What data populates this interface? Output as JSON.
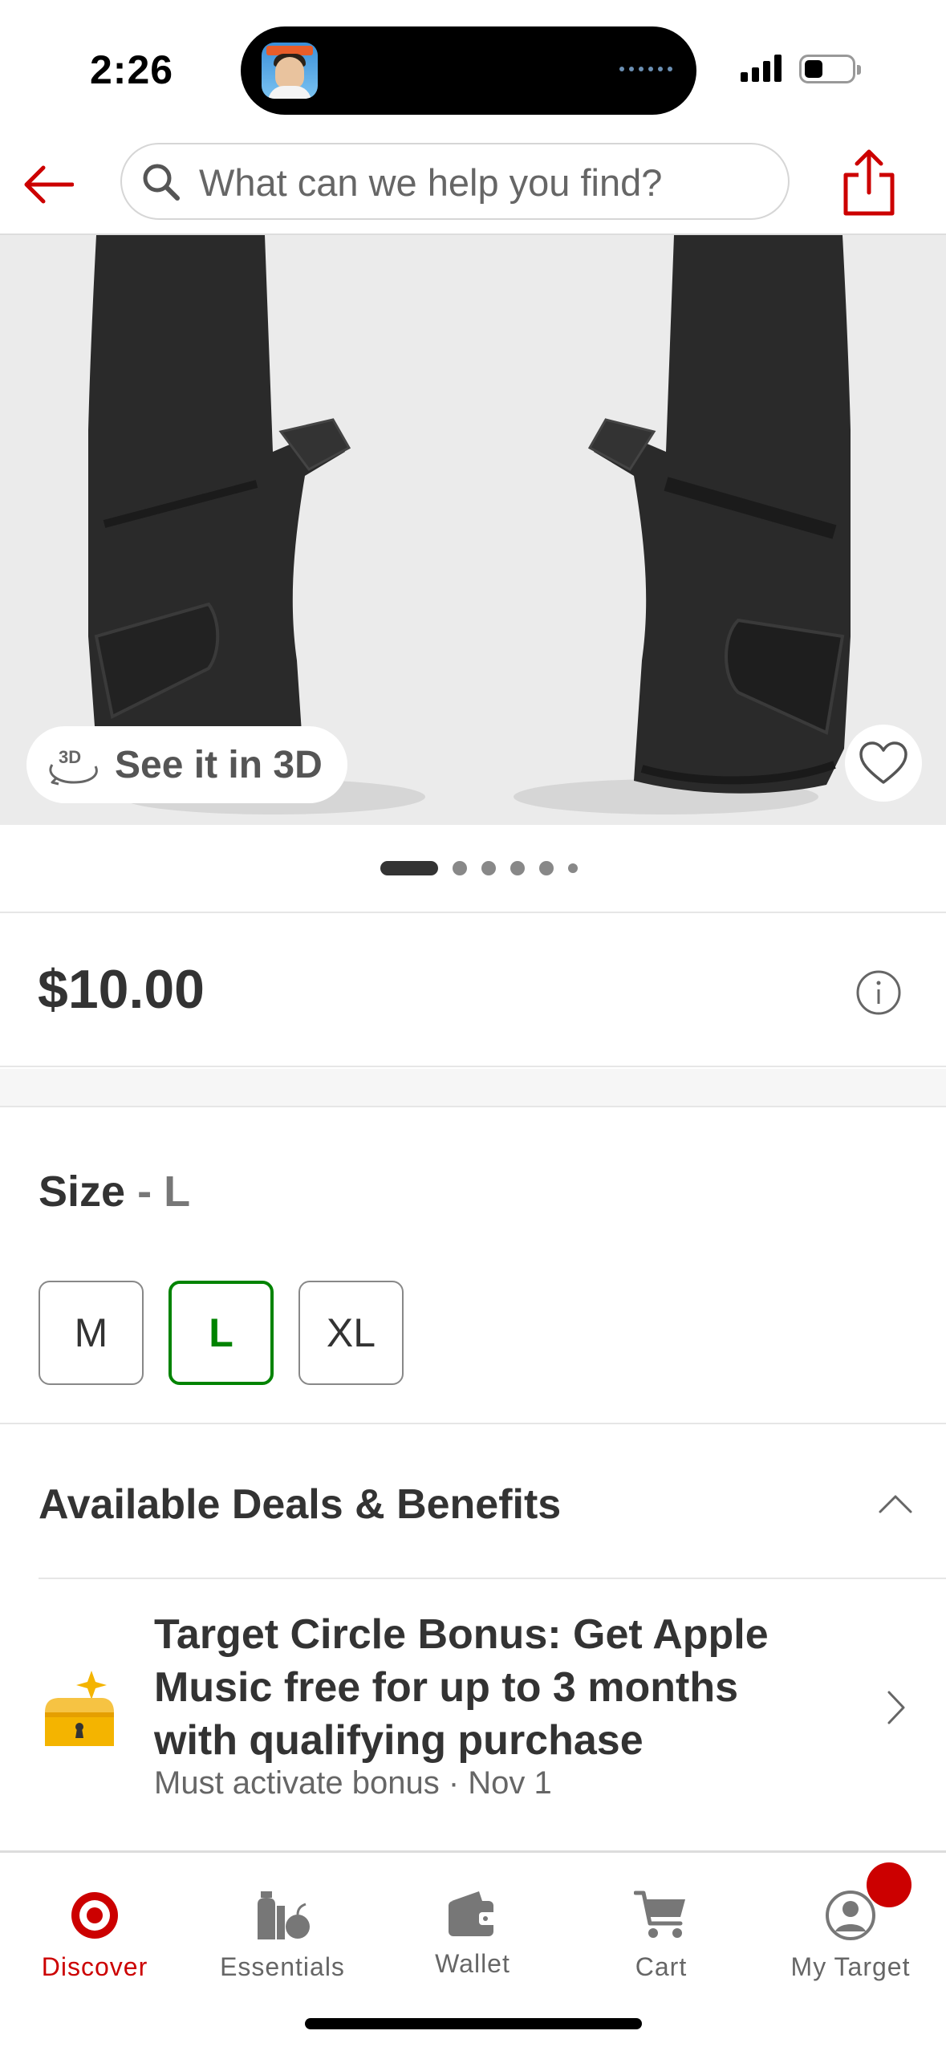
{
  "status_bar": {
    "time": "2:26"
  },
  "header": {
    "search_placeholder": "What can we help you find?",
    "back_icon": "arrow-left-icon",
    "share_icon": "share-icon",
    "accent_color": "#cc0000"
  },
  "product": {
    "see_3d_label": "See it in 3D",
    "see_3d_badge": "3D",
    "image_count": 6,
    "active_image_index": 0,
    "price": "$10.00"
  },
  "size": {
    "label": "Size",
    "separator": " - ",
    "selected": "L",
    "options": [
      "M",
      "L",
      "XL"
    ],
    "selected_color": "#008300"
  },
  "deals": {
    "title": "Available Deals & Benefits",
    "items": [
      {
        "title": "Target Circle Bonus: Get Apple Music free for up to 3 months with qualifying purchase",
        "subtitle": "Must activate bonus · Nov 1"
      }
    ]
  },
  "bottom_nav": {
    "items": [
      {
        "label": "Discover",
        "icon": "target-bullseye-icon",
        "active": true
      },
      {
        "label": "Essentials",
        "icon": "essentials-icon",
        "active": false
      },
      {
        "label": "Wallet",
        "icon": "wallet-icon",
        "active": false
      },
      {
        "label": "Cart",
        "icon": "cart-icon",
        "active": false
      },
      {
        "label": "My Target",
        "icon": "profile-icon",
        "active": false
      }
    ]
  }
}
